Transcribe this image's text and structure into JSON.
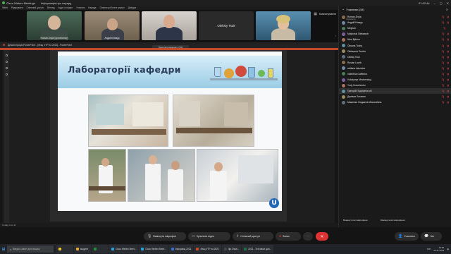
{
  "app": {
    "window_title": "Cisco Webex Meetings",
    "meeting_info": "Інформація про нараду",
    "header_time": "01:02:44",
    "menu": [
      "Файл",
      "Редагувати",
      "Спільний доступ",
      "Вигляд",
      "Аудіо та відео",
      "Учасник",
      "Нарада",
      "Сеанси роботи в групах",
      "Довідка"
    ]
  },
  "videos": [
    {
      "name": "Roman Zhyla (організатор)"
    },
    {
      "name": "Андрій Ковкур"
    },
    {
      "name": ""
    },
    {
      "name": "Oleksiy Tsuk"
    },
    {
      "name": ""
    }
  ],
  "strip": {
    "layout_label": "Компонування"
  },
  "share": {
    "banner": "Демонстрація PowerPoint - [Лекц VTP на 2021] - PowerPoint",
    "pill": "Перегляд зміненого (TM)",
    "status": "Слайд 4 из 11"
  },
  "slide": {
    "title": "Лабораторії кафедри",
    "logo": "U"
  },
  "participants": {
    "header": "Учасники (16)",
    "list": [
      {
        "name": "Roman Zhyla",
        "role": "Організатор",
        "muted": "🎙",
        "cam": "▮"
      },
      {
        "name": "Андрій Ковкур",
        "role": "",
        "muted": "🎙",
        "cam": "▮"
      },
      {
        "name": "Meghan",
        "role": "",
        "muted": "🎙",
        "cam": ""
      },
      {
        "name": "Malachuk Oleksandr",
        "role": "",
        "muted": "🎙",
        "cam": "▮"
      },
      {
        "name": "Nina Bykina",
        "role": "",
        "muted": "🎙",
        "cam": "▮"
      },
      {
        "name": "Oksana Tocha",
        "role": "",
        "muted": "🎙",
        "cam": "▮"
      },
      {
        "name": "Oleksandr Pechin",
        "role": "",
        "muted": "🎙",
        "cam": "▮"
      },
      {
        "name": "Oleksy Tsuk",
        "role": "",
        "muted": "🎙",
        "cam": "▮"
      },
      {
        "name": "Ruslan Lavrik",
        "role": "",
        "muted": "🎙",
        "cam": "▮"
      },
      {
        "name": "svitlana lukovska",
        "role": "",
        "muted": "🎙",
        "cam": "▮"
      },
      {
        "name": "Valentina Gaffenka",
        "role": "",
        "muted": "🎙",
        "cam": "▮"
      },
      {
        "name": "Volodymyr Mechenskyj",
        "role": "",
        "muted": "🎙",
        "cam": "▮"
      },
      {
        "name": "Yuriy Kravchenko",
        "role": "",
        "muted": "🎙",
        "cam": "▮"
      },
      {
        "name": "Григорій Подгорнов об",
        "role": "",
        "muted": "🎙",
        "cam": "▮"
      },
      {
        "name": "Даніели Лятанен",
        "role": "",
        "muted": "🎙",
        "cam": "▮"
      },
      {
        "name": "Машенко Людмила Миколаївна",
        "role": "",
        "muted": "🎙",
        "cam": "▮"
      }
    ],
    "mute_all": "Вимкнути всі мікрофони",
    "unmute_all": "Увімкнути всі мікрофони"
  },
  "controls": {
    "mic": "Вимкнути мікрофон",
    "video": "Зупинити відео",
    "share": "Спільний доступ",
    "record": "Запис",
    "more": "···",
    "end": "✕",
    "participants": "Учасники",
    "chat": "Чат"
  },
  "taskbar": {
    "search": "Введіть запит для пошуку",
    "tasks": [
      {
        "label": "",
        "color": "#f2c12e"
      },
      {
        "label": "модули",
        "color": "#e5a93a"
      },
      {
        "label": "",
        "color": "#1f8f3a"
      },
      {
        "label": "Cisco Webex Meet...",
        "color": "#2aa0d8"
      },
      {
        "label": "Cisco Webex Meet...",
        "color": "#2aa0d8"
      },
      {
        "label": "Інфорамц 2021",
        "color": "#2f6fd1"
      },
      {
        "label": "Лекц VTP на 2021",
        "color": "#c24a2a"
      },
      {
        "label": "Ilja Zhyla...",
        "color": "#444"
      },
      {
        "label": "2021 - Тестовые дан...",
        "color": "#1e6f3e"
      }
    ],
    "lang": "УКР",
    "time": "10:52",
    "date": "26.11.2021"
  },
  "colors": {
    "accent": "#c24a2a",
    "end_button": "#dd3333",
    "slide_title": "#2a3c5c"
  }
}
